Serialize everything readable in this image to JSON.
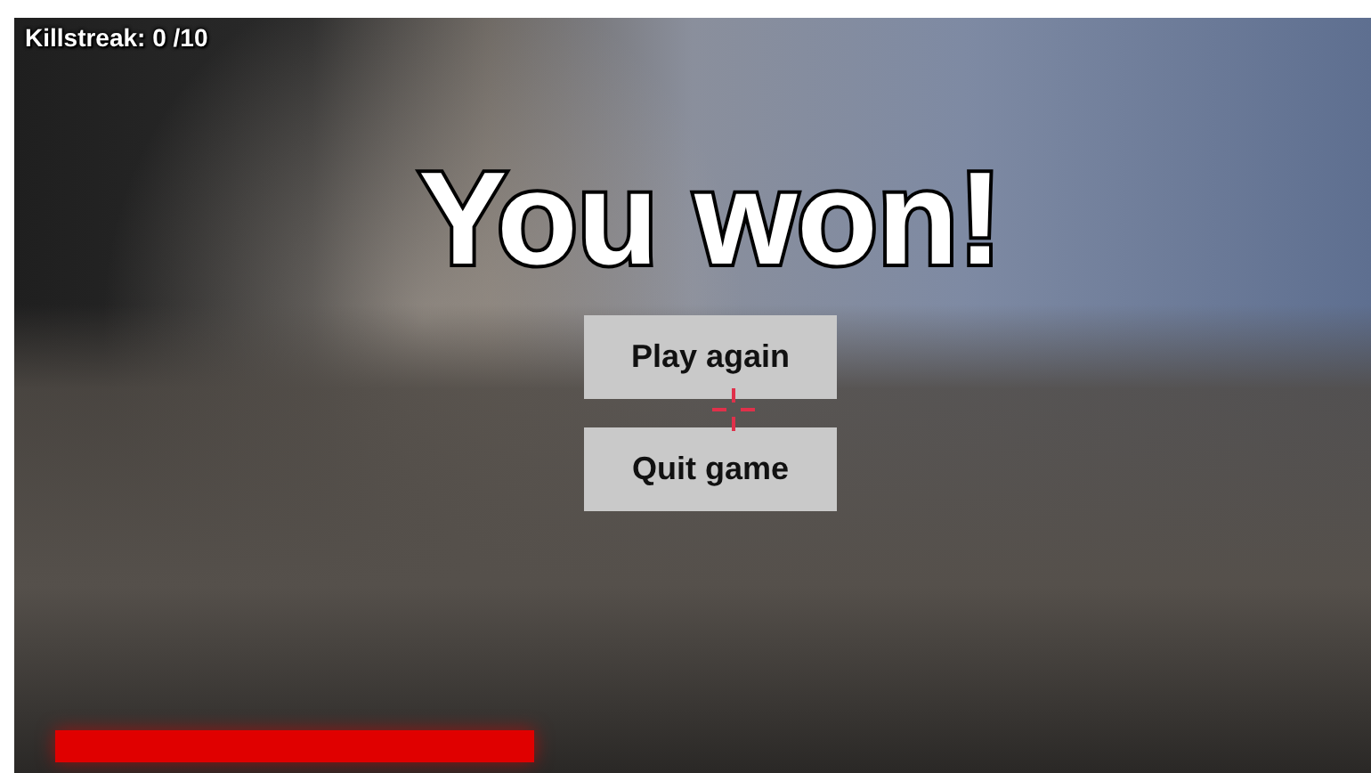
{
  "hud": {
    "killstreak": "Killstreak: 0 /10"
  },
  "title": "You won!",
  "buttons": [
    {
      "label": "Play again"
    },
    {
      "label": "Quit game"
    }
  ]
}
